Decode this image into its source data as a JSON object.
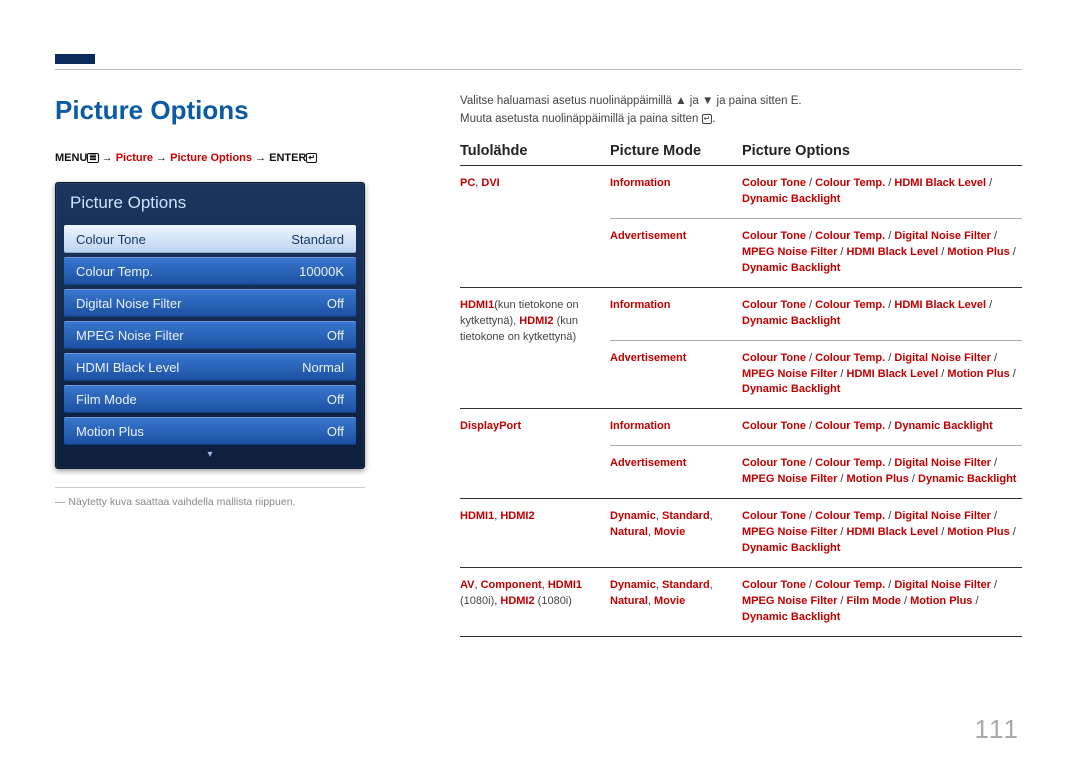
{
  "page_title": "Picture Options",
  "breadcrumb": {
    "menu": "MENU",
    "menu_icon": "𝌆",
    "arrow": " → ",
    "picture": "Picture",
    "po": "Picture Options",
    "enter": "ENTER",
    "enter_icon": "↵"
  },
  "osd": {
    "title": "Picture Options",
    "rows": [
      {
        "label": "Colour Tone",
        "value": "Standard",
        "selected": true
      },
      {
        "label": "Colour Temp.",
        "value": "10000K",
        "selected": false
      },
      {
        "label": "Digital Noise Filter",
        "value": "Off",
        "selected": false
      },
      {
        "label": "MPEG Noise Filter",
        "value": "Off",
        "selected": false
      },
      {
        "label": "HDMI Black Level",
        "value": "Normal",
        "selected": false
      },
      {
        "label": "Film Mode",
        "value": "Off",
        "selected": false
      },
      {
        "label": "Motion Plus",
        "value": "Off",
        "selected": false
      }
    ],
    "down": "▾"
  },
  "footnote": "― Näytetty kuva saattaa vaihdella mallista riippuen.",
  "instructions": {
    "l1_a": "Valitse haluamasi asetus nuolinäppäimillä ",
    "l1_b": "▲",
    "l1_c": " ja ",
    "l1_d": "▼",
    "l1_e": " ja paina sitten E.",
    "l2_a": "Muuta asetusta nuolinäppäimillä ja paina sitten ",
    "l2_b": "↵",
    "l2_c": "."
  },
  "headers": {
    "c1": "Tulolähde",
    "c2": "Picture Mode",
    "c3": "Picture Options"
  },
  "rows": [
    {
      "source_html": "<span class='red'>PC</span>, <span class='red'>DVI</span>",
      "subs": [
        {
          "mode": "<span class='red'>Information</span>",
          "opts": "<span class='red'>Colour Tone</span> / <span class='red'>Colour Temp.</span> / <span class='red'>HDMI Black Level</span> / <span class='red'>Dynamic Backlight</span>"
        },
        {
          "mode": "<span class='red'>Advertisement</span>",
          "opts": "<span class='red'>Colour Tone</span> / <span class='red'>Colour Temp.</span> / <span class='red'>Digital Noise Filter</span> / <span class='red'>MPEG Noise Filter</span> / <span class='red'>HDMI Black Level</span> / <span class='red'>Motion Plus</span> / <span class='red'>Dynamic Backlight</span>"
        }
      ]
    },
    {
      "source_html": "<span class='red'>HDMI1</span><span class='plain'>(kun tietokone on kytkettynä), </span><span class='red'>HDMI2</span><span class='plain'> (kun tietokone on kytkettynä)</span>",
      "subs": [
        {
          "mode": "<span class='red'>Information</span>",
          "opts": "<span class='red'>Colour Tone</span> / <span class='red'>Colour Temp.</span> / <span class='red'>HDMI Black Level</span> / <span class='red'>Dynamic Backlight</span>"
        },
        {
          "mode": "<span class='red'>Advertisement</span>",
          "opts": "<span class='red'>Colour Tone</span> / <span class='red'>Colour Temp.</span> / <span class='red'>Digital Noise Filter</span> / <span class='red'>MPEG Noise Filter</span> / <span class='red'>HDMI Black Level</span> / <span class='red'>Motion Plus</span> / <span class='red'>Dynamic Backlight</span>"
        }
      ]
    },
    {
      "source_html": "<span class='red'>DisplayPort</span>",
      "subs": [
        {
          "mode": "<span class='red'>Information</span>",
          "opts": "<span class='red'>Colour Tone</span> / <span class='red'>Colour Temp.</span> / <span class='red'>Dynamic Backlight</span>"
        },
        {
          "mode": "<span class='red'>Advertisement</span>",
          "opts": "<span class='red'>Colour Tone</span> / <span class='red'>Colour Temp.</span> / <span class='red'>Digital Noise Filter</span> / <span class='red'>MPEG Noise Filter</span> / <span class='red'>Motion Plus</span> / <span class='red'>Dynamic Backlight</span>"
        }
      ]
    },
    {
      "source_html": "<span class='red'>HDMI1</span>, <span class='red'>HDMI2</span>",
      "subs": [
        {
          "mode": "<span class='red'>Dynamic</span>, <span class='red'>Standard</span>, <span class='red'>Natural</span>, <span class='red'>Movie</span>",
          "opts": "<span class='red'>Colour Tone</span> / <span class='red'>Colour Temp.</span> / <span class='red'>Digital Noise Filter</span> / <span class='red'>MPEG Noise Filter</span> / <span class='red'>HDMI Black Level</span> / <span class='red'>Motion Plus</span> / <span class='red'>Dynamic Backlight</span>"
        }
      ]
    },
    {
      "source_html": "<span class='red'>AV</span>, <span class='red'>Component</span>, <span class='red'>HDMI1</span> <span class='plain'>(1080i)</span>, <span class='red'>HDMI2</span> <span class='plain'>(1080i)</span>",
      "subs": [
        {
          "mode": "<span class='red'>Dynamic</span>, <span class='red'>Standard</span>, <span class='red'>Natural</span>, <span class='red'>Movie</span>",
          "opts": "<span class='red'>Colour Tone</span> / <span class='red'>Colour Temp.</span> / <span class='red'>Digital Noise Filter</span> / <span class='red'>MPEG Noise Filter</span> / <span class='red'>Film Mode</span> / <span class='red'>Motion Plus</span> / <span class='red'>Dynamic Backlight</span>"
        }
      ]
    }
  ],
  "page_number": "111"
}
